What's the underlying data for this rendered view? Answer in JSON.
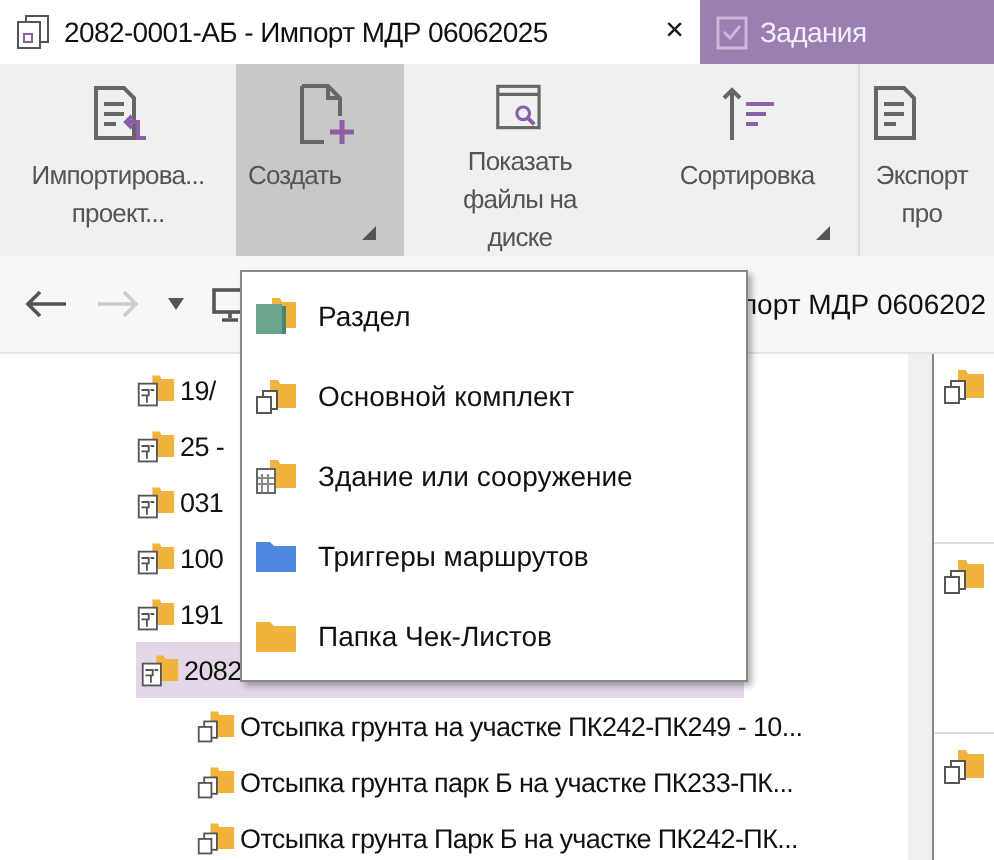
{
  "tabs": [
    {
      "label": "2082-0001-АБ - Импорт МДР 06062025",
      "selected": true,
      "close": "×"
    },
    {
      "label": "Задания",
      "selected": false
    }
  ],
  "ribbon": [
    {
      "label": "Импортирова... проект...",
      "kind": "import",
      "selected": false,
      "dropdown": false
    },
    {
      "label": "Создать",
      "kind": "create",
      "selected": true,
      "dropdown": true
    },
    {
      "label": "Показать файлы на диске",
      "kind": "show",
      "selected": false,
      "dropdown": false
    },
    {
      "label": "Сортировка",
      "kind": "sort",
      "selected": false,
      "dropdown": true
    },
    {
      "label": "Экспорт про",
      "kind": "export",
      "selected": false,
      "dropdown": false
    }
  ],
  "breadcrumb": {
    "back_disabled": false,
    "forward_disabled": true,
    "path": "порт МДР 0606202"
  },
  "tree": [
    {
      "label": "19/",
      "selected": false
    },
    {
      "label": "25 -",
      "selected": false
    },
    {
      "label": "031",
      "selected": false
    },
    {
      "label": "100",
      "selected": false
    },
    {
      "label": "191",
      "selected": false
    },
    {
      "label": "2082",
      "selected": true,
      "children": [
        {
          "label": "Отсыпка грунта на участке ПК242-ПК249 - 10..."
        },
        {
          "label": "Отсыпка грунта парк Б на участке ПК233-ПК..."
        },
        {
          "label": "Отсыпка грунта Парк Б на участке ПК242-ПК..."
        }
      ]
    }
  ],
  "menu": [
    {
      "label": "Раздел",
      "kind": "section"
    },
    {
      "label": "Основной комплект",
      "kind": "kit"
    },
    {
      "label": "Здание или сооружение",
      "kind": "building"
    },
    {
      "label": "Триггеры маршрутов",
      "kind": "trigger"
    },
    {
      "label": "Папка Чек-Листов",
      "kind": "checklist"
    }
  ]
}
